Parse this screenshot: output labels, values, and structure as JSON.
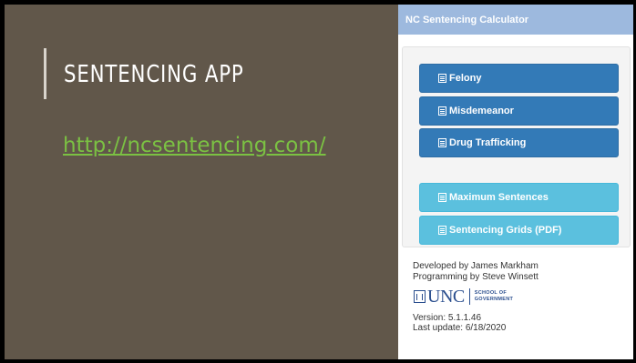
{
  "slide": {
    "title": "SENTENCING APP",
    "link_text": "http://ncsentencing.com/"
  },
  "app": {
    "header_title": "NC Sentencing Calculator",
    "primary_buttons": [
      "Felony",
      "Misdemeanor",
      "Drug Trafficking"
    ],
    "info_buttons": [
      "Maximum Sentences",
      "Sentencing Grids (PDF)"
    ],
    "developed_by": "Developed by James Markham",
    "programming_by": "Programming by Steve Winsett",
    "logo": {
      "name": "UNC",
      "line1": "SCHOOL OF",
      "line2": "GOVERNMENT"
    },
    "version": "Version: 5.1.1.46",
    "last_update": "Last update: 6/18/2020"
  },
  "colors": {
    "slide_bg": "#61574a",
    "link": "#7bc143",
    "header_bg": "#9db9de",
    "primary_btn": "#337ab7",
    "info_btn": "#5bc0de",
    "logo": "#2a4e8e"
  },
  "icons": {
    "button_icon": "list-alt-icon",
    "logo_icon": "unc-seal-icon"
  }
}
